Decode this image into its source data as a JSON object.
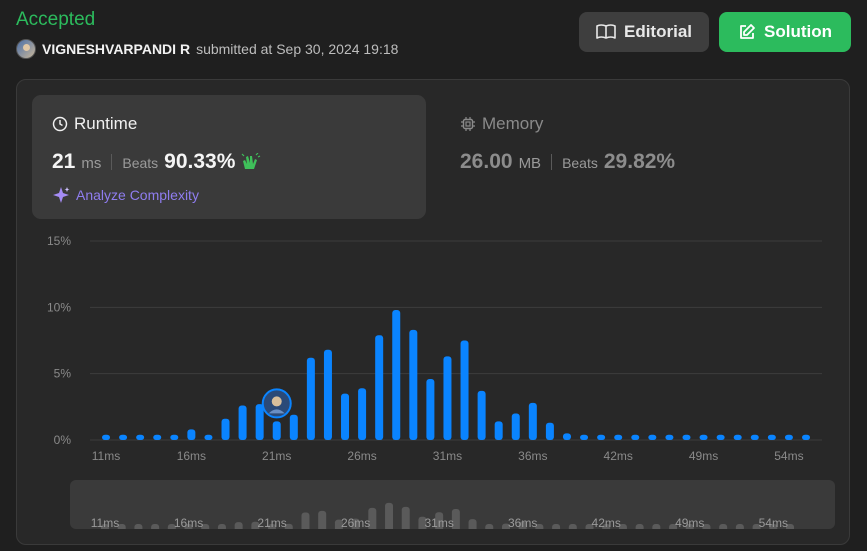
{
  "header": {
    "status": "Accepted",
    "username": "VIGNESHVARPANDI R",
    "submitted_text": "submitted at Sep 30, 2024 19:18",
    "editorial_label": "Editorial",
    "solution_label": "Solution"
  },
  "runtime": {
    "title": "Runtime",
    "value": "21",
    "unit": "ms",
    "beats_label": "Beats",
    "beats_value": "90.33%",
    "analyze_label": "Analyze Complexity"
  },
  "memory": {
    "title": "Memory",
    "value": "26.00",
    "unit": "MB",
    "beats_label": "Beats",
    "beats_value": "29.82%"
  },
  "colors": {
    "accepted": "#2cbb5d",
    "bar": "#0a84ff",
    "accent_purple": "#8f7df0"
  },
  "icons": {
    "editorial": "book-icon",
    "solution": "edit-icon",
    "runtime": "clock-icon",
    "memory": "chip-icon",
    "analyze": "sparkle-icon",
    "beats": "clapping-hands-icon"
  },
  "chart_data": {
    "type": "bar",
    "y_ticks": [
      "0%",
      "5%",
      "10%",
      "15%"
    ],
    "ylim": [
      0,
      15
    ],
    "x_tick_labels": [
      "11ms",
      "16ms",
      "21ms",
      "26ms",
      "31ms",
      "36ms",
      "42ms",
      "49ms",
      "54ms"
    ],
    "x_tick_positions": [
      11,
      16,
      21,
      26,
      31,
      36,
      41,
      46,
      51
    ],
    "x": [
      11,
      12,
      13,
      14,
      15,
      16,
      17,
      18,
      19,
      20,
      21,
      22,
      23,
      24,
      25,
      26,
      27,
      28,
      29,
      30,
      31,
      32,
      33,
      34,
      35,
      36,
      37,
      38,
      39,
      40,
      41,
      42,
      43,
      44,
      45,
      46,
      47,
      48,
      49,
      50,
      51,
      52
    ],
    "values": [
      0.4,
      0.4,
      0.4,
      0.4,
      0.4,
      0.8,
      0.4,
      1.6,
      2.6,
      2.7,
      1.4,
      1.9,
      6.2,
      6.8,
      3.5,
      3.9,
      7.9,
      9.8,
      8.3,
      4.6,
      6.3,
      7.5,
      3.7,
      1.4,
      2.0,
      2.8,
      1.3,
      0.5,
      0.4,
      0.4,
      0.4,
      0.4,
      0.4,
      0.4,
      0.4,
      0.4,
      0.4,
      0.4,
      0.4,
      0.4,
      0.4,
      0.4
    ],
    "user_marker_x": 21,
    "grid": true
  }
}
